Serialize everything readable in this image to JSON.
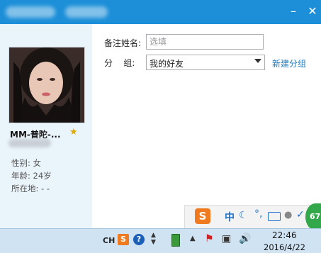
{
  "window": {
    "minimize_icon": "minimize-icon",
    "close_icon": "close-icon"
  },
  "profile": {
    "nickname": "MM-普陀-...",
    "gender": "性别: 女",
    "age": "年龄: 24岁",
    "location": "所在地:  -   -"
  },
  "form": {
    "remark_label": "备注姓名:",
    "remark_placeholder": "选填",
    "group_label": "分    组:",
    "group_value": "我的好友",
    "new_group_link": "新建分组"
  },
  "ime": {
    "logo": "S",
    "mode": "中",
    "badge": "67"
  },
  "taskbar": {
    "lang": "CH",
    "sogou": "S",
    "help": "?",
    "time": "22:46",
    "date": "2016/4/22"
  },
  "colors": {
    "titlebar": "#1c8fd8",
    "link": "#1e7bc4",
    "panel": "#eaf4fb"
  }
}
